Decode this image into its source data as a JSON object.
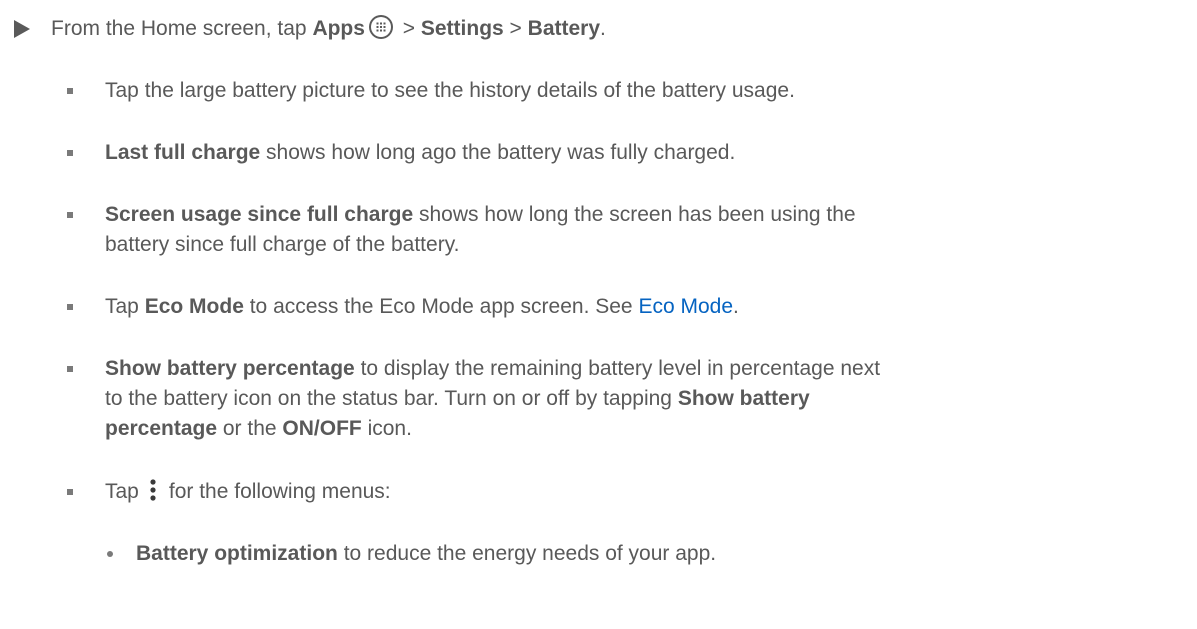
{
  "step": {
    "prefix": "From the Home screen, tap ",
    "apps": "Apps",
    "sep1": " > ",
    "settings": "Settings",
    "sep2": " > ",
    "battery": "Battery",
    "end": "."
  },
  "bullets": {
    "b1": {
      "text": "Tap the large battery picture to see the history details of the battery usage."
    },
    "b2": {
      "bold": "Last full charge",
      "text": " shows how long ago the battery was fully charged."
    },
    "b3": {
      "bold": "Screen usage since full charge",
      "text1": " shows how long the screen has been using the",
      "text2": "battery since full charge of the battery."
    },
    "b4": {
      "pre": "Tap ",
      "bold": "Eco Mode",
      "mid": " to access the Eco Mode app screen. See ",
      "link": "Eco Mode",
      "end": "."
    },
    "b5": {
      "bold": "Show battery percentage",
      "text1": " to display the remaining battery level in percentage next",
      "text2a": "to the battery icon on the status bar. Turn on or off by tapping ",
      "bold2a": "Show battery",
      "bold2b": "percentage",
      "text3a": " or the ",
      "bold3": "ON/OFF",
      "text3b": " icon."
    },
    "b6": {
      "pre": "Tap",
      "text": "for the following menus:"
    },
    "sub1": {
      "bold": "Battery optimization",
      "text": " to reduce the energy needs of your app."
    }
  },
  "icons": {
    "arrow": "triangle-right-icon",
    "apps": "apps-grid-icon",
    "menu": "more-vertical-icon"
  },
  "colors": {
    "text": "#595959",
    "link": "#0563c1"
  }
}
